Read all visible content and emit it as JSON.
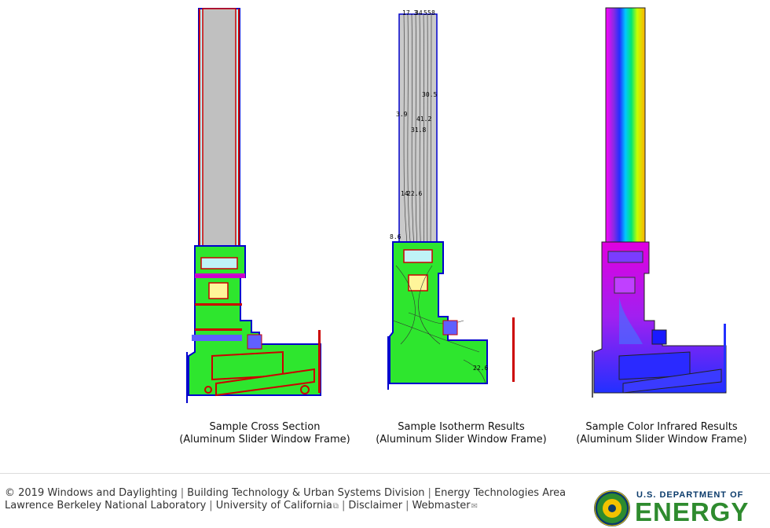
{
  "figures": [
    {
      "caption_line1": "Sample Cross Section",
      "caption_line2": "(Aluminum Slider Window Frame)"
    },
    {
      "caption_line1": "Sample Isotherm Results",
      "caption_line2": "(Aluminum Slider Window Frame)",
      "labels": [
        "17.3",
        "34",
        "5",
        "5",
        "8",
        "30.5",
        "3.9",
        "41.2",
        "31.8",
        "14",
        "22.6",
        "8.6",
        "22.6"
      ]
    },
    {
      "caption_line1": "Sample Color Infrared Results",
      "caption_line2": "(Aluminum Slider Window Frame)"
    }
  ],
  "footer": {
    "copyright": "© 2019",
    "links_line1": [
      "Windows and Daylighting",
      "Building Technology & Urban Systems Division",
      "Energy Technologies Area"
    ],
    "lab": "Lawrence Berkeley National Laboratory",
    "uc": "University of California",
    "disclaimer": "Disclaimer",
    "webmaster": "Webmaster"
  },
  "doe_logo": {
    "top_text": "U.S. DEPARTMENT OF",
    "main_text": "ENERGY",
    "icon": "doe-seal-icon"
  },
  "colors": {
    "frame_green": "#2ee62e",
    "glass_gray": "#c0c0c0",
    "glass_cyan": "#bff3f7",
    "outline_blue": "#0000cc",
    "outline_red": "#cc0000",
    "infrared_blue": "#2230ff",
    "infrared_magenta": "#d000d0"
  }
}
